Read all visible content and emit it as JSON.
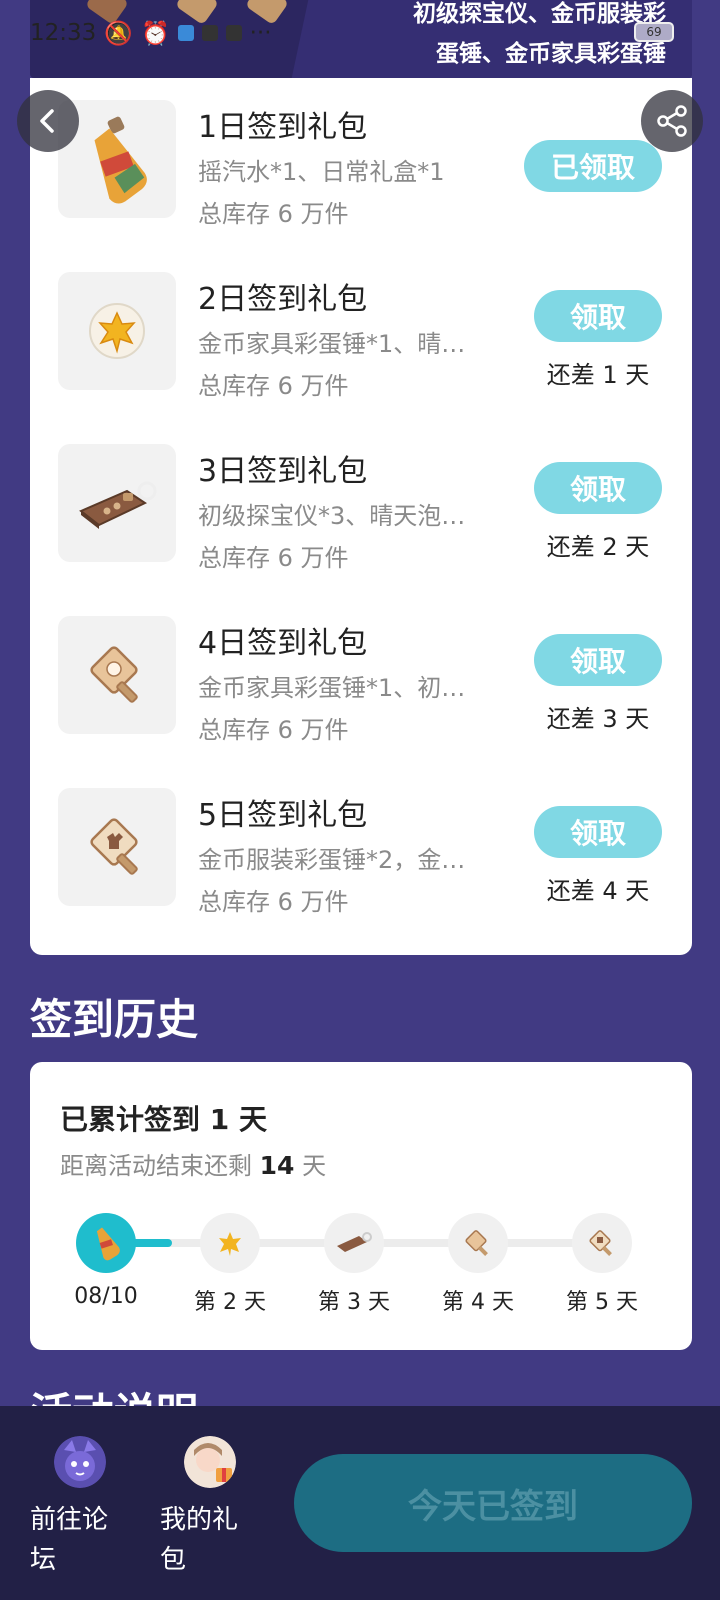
{
  "banner": {
    "line1": "初级探宝仪、金币服装彩",
    "line2": "蛋锤、金币家具彩蛋锤"
  },
  "status": {
    "time": "12:33",
    "battery": "69"
  },
  "gifts": [
    {
      "title": "1日签到礼包",
      "desc": "摇汽水*1、日常礼盒*1",
      "stock": "总库存 6 万件",
      "button": "已领取",
      "remain": "",
      "icon": "soda-bottle-icon"
    },
    {
      "title": "2日签到礼包",
      "desc": "金币家具彩蛋锤*1、晴…",
      "stock": "总库存 6 万件",
      "button": "领取",
      "remain": "还差 1 天",
      "icon": "sunny-bubble-icon"
    },
    {
      "title": "3日签到礼包",
      "desc": "初级探宝仪*3、晴天泡…",
      "stock": "总库存 6 万件",
      "button": "领取",
      "remain": "还差 2 天",
      "icon": "treasure-detector-icon"
    },
    {
      "title": "4日签到礼包",
      "desc": "金币家具彩蛋锤*1、初…",
      "stock": "总库存 6 万件",
      "button": "领取",
      "remain": "还差 3 天",
      "icon": "furniture-hammer-icon"
    },
    {
      "title": "5日签到礼包",
      "desc": "金币服装彩蛋锤*2，金…",
      "stock": "总库存 6 万件",
      "button": "领取",
      "remain": "还差 4 天",
      "icon": "clothing-hammer-icon"
    }
  ],
  "history": {
    "section_title": "签到历史",
    "total_label": "已累计签到 1 天",
    "remaining_prefix": "距离活动结束还剩",
    "remaining_days": "14",
    "remaining_suffix": "天",
    "progress": 0.2,
    "days": [
      "08/10",
      "第 2 天",
      "第 3 天",
      "第 4 天",
      "第 5 天"
    ]
  },
  "next_section_title": "活动说明",
  "bottom": {
    "forum_label": "前往论坛",
    "gifts_label": "我的礼包",
    "signed_button": "今天已签到"
  },
  "colors": {
    "background": "#413a83",
    "accent": "#1fbdcd",
    "claim_button": "#80d8e4",
    "bottom_bar": "#222046",
    "signed_button": "#1d6d83"
  }
}
